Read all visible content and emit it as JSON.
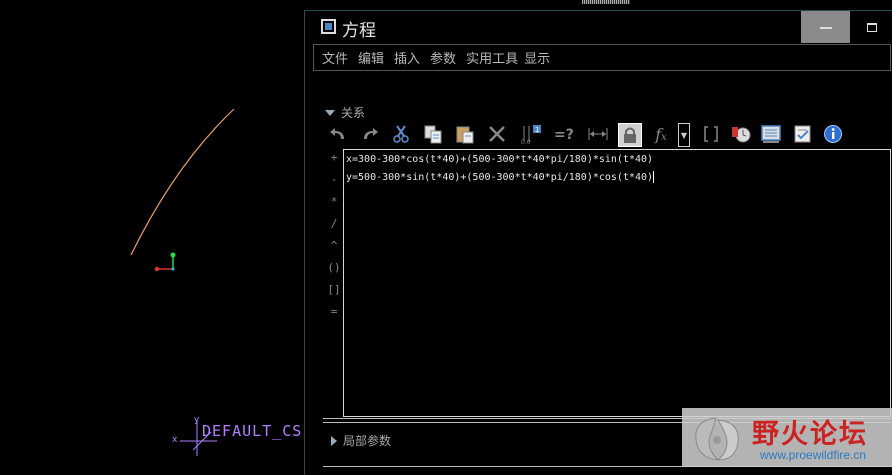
{
  "dialog": {
    "title": "方程",
    "menu": [
      "文件",
      "编辑",
      "插入",
      "参数",
      "实用工具",
      "显示"
    ],
    "relations_label": "关系",
    "local_params_label": "局部参数",
    "equations": [
      "x=300-300*cos(t*40)+(500-300*t*40*pi/180)*sin(t*40)",
      "y=500-300*sin(t*40)+(500-300*t*40*pi/180)*cos(t*40)"
    ],
    "operators": [
      "+",
      "-",
      "*",
      "/",
      "^",
      "()",
      "[]",
      "="
    ],
    "toolbar_icons": [
      "undo-icon",
      "redo-icon",
      "cut-icon",
      "copy-icon",
      "paste-icon",
      "delete-icon",
      "sort-icon",
      "evaluate-icon",
      "measure-icon",
      "lock-icon",
      "function-icon",
      "dropdown-icon",
      "brackets-icon",
      "verify-icon",
      "display-icon",
      "check-icon",
      "info-icon"
    ],
    "fx_glyph": "f",
    "fx_sub": "x"
  },
  "viewport": {
    "csys_label": "DEFAULT_CS",
    "curve_color": "#f0a060",
    "csys_color": "#b080ff"
  },
  "watermark": {
    "title": "野火论坛",
    "url": "www.proewildfire.cn"
  }
}
